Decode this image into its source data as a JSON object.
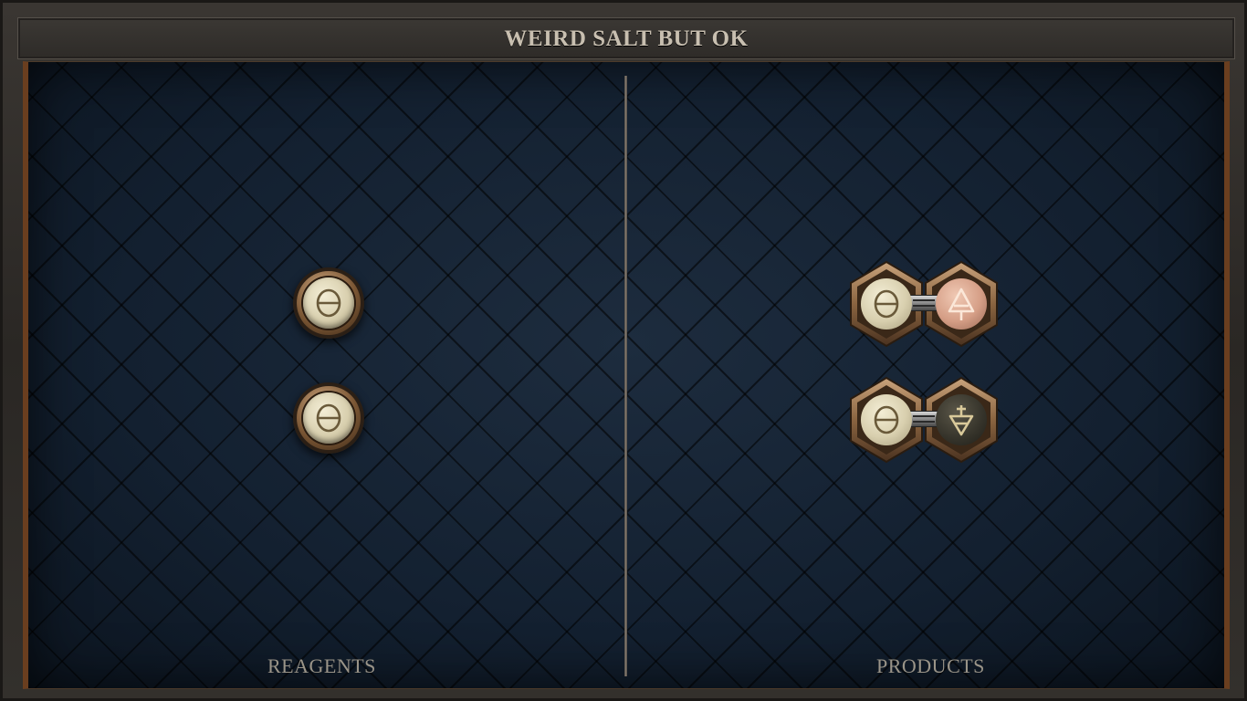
{
  "puzzle": {
    "title": "WEIRD SALT BUT OK"
  },
  "sections": {
    "reagents_label": "REAGENTS",
    "products_label": "PRODUCTS"
  },
  "reagents": [
    {
      "element": "salt",
      "icon": "salt-icon"
    },
    {
      "element": "salt",
      "icon": "salt-icon"
    }
  ],
  "products": [
    {
      "atoms": [
        {
          "element": "salt",
          "icon": "salt-icon"
        },
        {
          "element": "fire",
          "icon": "fire-icon"
        }
      ],
      "bond": "normal"
    },
    {
      "atoms": [
        {
          "element": "salt",
          "icon": "salt-icon"
        },
        {
          "element": "earth",
          "icon": "earth-icon"
        }
      ],
      "bond": "normal"
    }
  ],
  "colors": {
    "salt": "#e8e0c4",
    "fire": "#dca48c",
    "earth": "#3a382e",
    "frame_accent": "#6a3e1f",
    "title_text": "#c8bfb0"
  }
}
